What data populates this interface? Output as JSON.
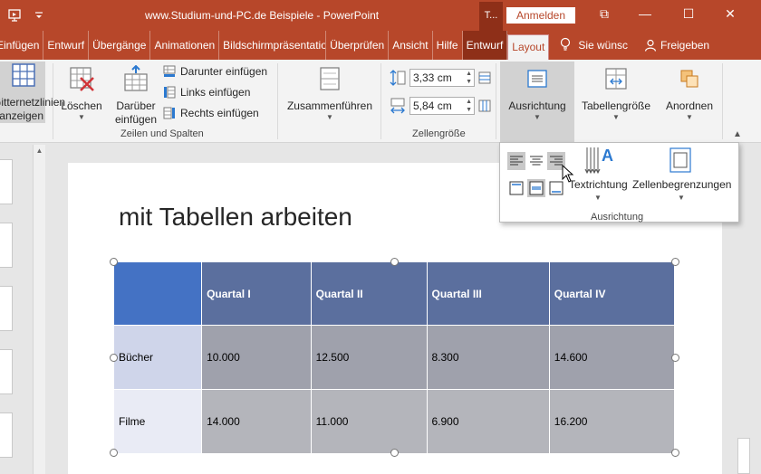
{
  "titlebar": {
    "title": "www.Studium-und-PC.de Beispiele  -  PowerPoint",
    "context_abbrev": "T...",
    "signin": "Anmelden",
    "restore_glyph": "⧉",
    "minimize_glyph": "—",
    "maximize_glyph": "☐",
    "close_glyph": "✕"
  },
  "tabs": [
    {
      "label": "Einfügen"
    },
    {
      "label": "Entwurf"
    },
    {
      "label": "Übergänge"
    },
    {
      "label": "Animationen"
    },
    {
      "label": "Bildschirmpräsentatio"
    },
    {
      "label": "Überprüfen"
    },
    {
      "label": "Ansicht"
    },
    {
      "label": "Hilfe"
    },
    {
      "label": "Entwurf"
    },
    {
      "label": "Layout"
    }
  ],
  "tellme": "Sie wünsc",
  "share": "Freigeben",
  "ribbon": {
    "gridlines": "Gitternetzlinien anzeigen",
    "delete": "Löschen",
    "insert_above": "Darüber einfügen",
    "insert_below": "Darunter einfügen",
    "insert_left": "Links einfügen",
    "insert_right": "Rechts einfügen",
    "group_rows_cols": "Zeilen und Spalten",
    "merge": "Zusammenführen",
    "height_value": "3,33 cm",
    "width_value": "5,84 cm",
    "group_cellsize": "Zellengröße",
    "alignment": "Ausrichtung",
    "tablesize": "Tabellengröße",
    "arrange": "Anordnen"
  },
  "panel": {
    "text_direction": "Textrichtung",
    "cell_margins": "Zellenbegrenzungen",
    "group_label": "Ausrichtung"
  },
  "slide": {
    "title": "mit Tabellen arbeiten",
    "table": {
      "headers": [
        "",
        "Quartal I",
        "Quartal II",
        "Quartal III",
        "Quartal IV"
      ],
      "rows": [
        [
          "Bücher",
          "10.000",
          "12.500",
          "8.300",
          "14.600"
        ],
        [
          "Filme",
          "14.000",
          "11.000",
          "6.900",
          "16.200"
        ]
      ]
    }
  },
  "colors": {
    "accent": "#b7472a",
    "header": "#5b6f9e",
    "corner": "#4472c4"
  }
}
